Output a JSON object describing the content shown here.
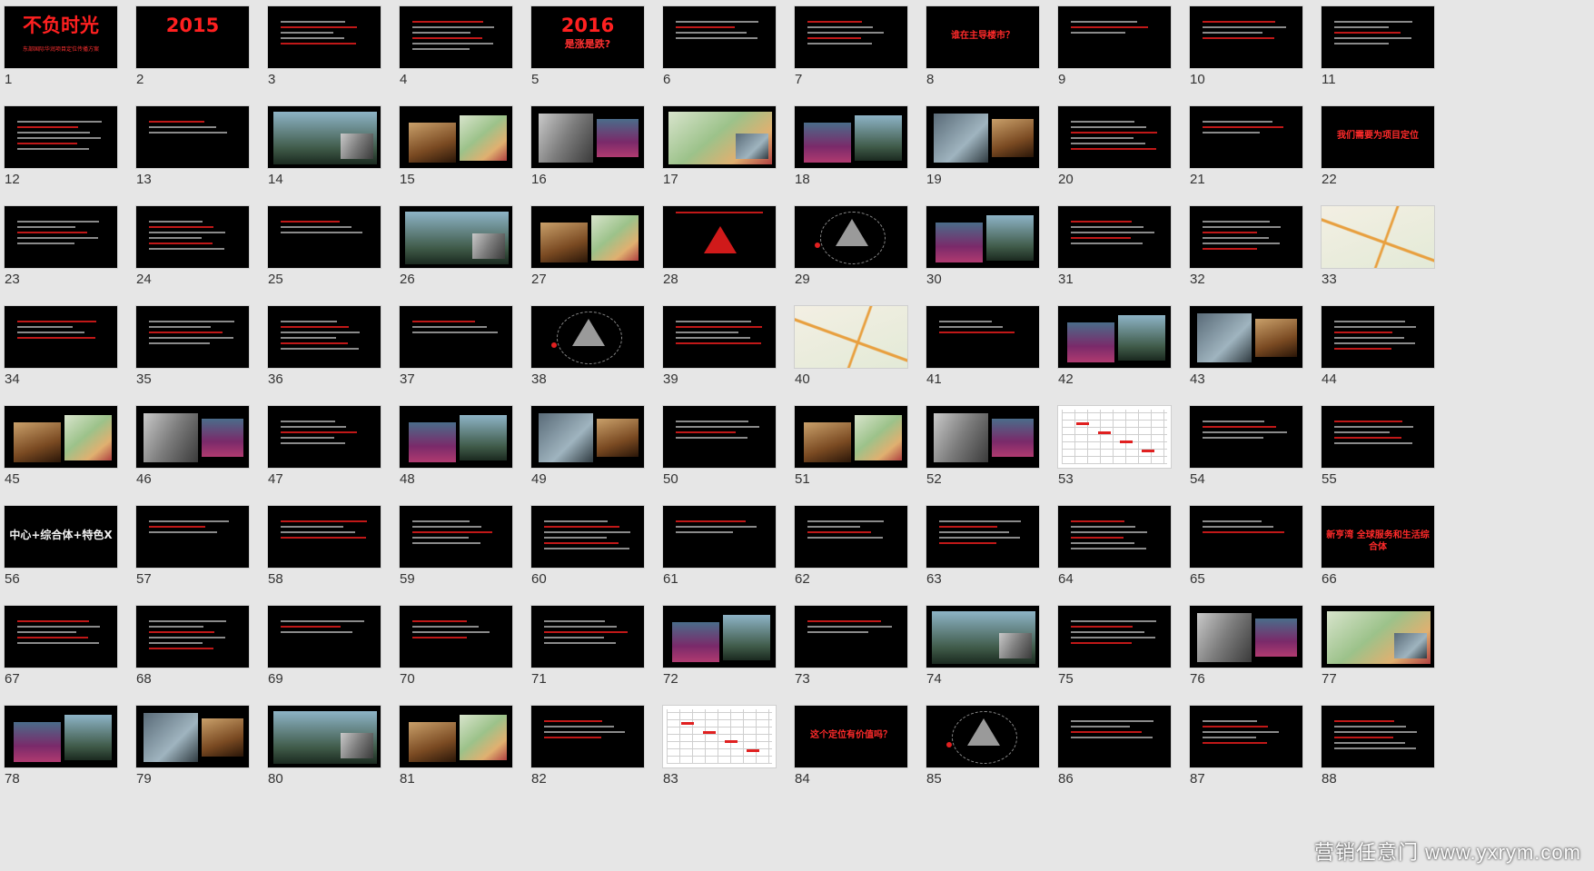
{
  "app": {
    "view": "slide-sorter"
  },
  "slides": [
    {
      "n": "1",
      "type": "title",
      "big": "不负时光",
      "sub": "东部国际华润项目定位传播方案"
    },
    {
      "n": "2",
      "type": "title",
      "big": "2015",
      "sub": ""
    },
    {
      "n": "3",
      "type": "text"
    },
    {
      "n": "4",
      "type": "text"
    },
    {
      "n": "5",
      "type": "title",
      "big": "2016",
      "sub": "是涨是跌?"
    },
    {
      "n": "6",
      "type": "text"
    },
    {
      "n": "7",
      "type": "text"
    },
    {
      "n": "8",
      "type": "mid",
      "mid": "谁在主导楼市？"
    },
    {
      "n": "9",
      "type": "text"
    },
    {
      "n": "10",
      "type": "text"
    },
    {
      "n": "11",
      "type": "text"
    },
    {
      "n": "12",
      "type": "text"
    },
    {
      "n": "13",
      "type": "text"
    },
    {
      "n": "14",
      "type": "photo"
    },
    {
      "n": "15",
      "type": "photo"
    },
    {
      "n": "16",
      "type": "photo"
    },
    {
      "n": "17",
      "type": "photo"
    },
    {
      "n": "18",
      "type": "photo"
    },
    {
      "n": "19",
      "type": "photo"
    },
    {
      "n": "20",
      "type": "text"
    },
    {
      "n": "21",
      "type": "text"
    },
    {
      "n": "22",
      "type": "mid",
      "mid": "我们需要为项目定位"
    },
    {
      "n": "23",
      "type": "text"
    },
    {
      "n": "24",
      "type": "text"
    },
    {
      "n": "25",
      "type": "text"
    },
    {
      "n": "26",
      "type": "photo"
    },
    {
      "n": "27",
      "type": "photo"
    },
    {
      "n": "28",
      "type": "triangle"
    },
    {
      "n": "29",
      "type": "ellipse"
    },
    {
      "n": "30",
      "type": "photo"
    },
    {
      "n": "31",
      "type": "text"
    },
    {
      "n": "32",
      "type": "text"
    },
    {
      "n": "33",
      "type": "map"
    },
    {
      "n": "34",
      "type": "text"
    },
    {
      "n": "35",
      "type": "text"
    },
    {
      "n": "36",
      "type": "text"
    },
    {
      "n": "37",
      "type": "text"
    },
    {
      "n": "38",
      "type": "ellipse"
    },
    {
      "n": "39",
      "type": "text"
    },
    {
      "n": "40",
      "type": "map"
    },
    {
      "n": "41",
      "type": "text"
    },
    {
      "n": "42",
      "type": "photo"
    },
    {
      "n": "43",
      "type": "photo"
    },
    {
      "n": "44",
      "type": "text"
    },
    {
      "n": "45",
      "type": "photo"
    },
    {
      "n": "46",
      "type": "photo"
    },
    {
      "n": "47",
      "type": "text"
    },
    {
      "n": "48",
      "type": "photo"
    },
    {
      "n": "49",
      "type": "photo"
    },
    {
      "n": "50",
      "type": "text"
    },
    {
      "n": "51",
      "type": "photo"
    },
    {
      "n": "52",
      "type": "photo"
    },
    {
      "n": "53",
      "type": "table"
    },
    {
      "n": "54",
      "type": "text"
    },
    {
      "n": "55",
      "type": "text"
    },
    {
      "n": "56",
      "type": "mid",
      "mid": "中心+综合体+特色X",
      "white": true
    },
    {
      "n": "57",
      "type": "text"
    },
    {
      "n": "58",
      "type": "text"
    },
    {
      "n": "59",
      "type": "text"
    },
    {
      "n": "60",
      "type": "text"
    },
    {
      "n": "61",
      "type": "text"
    },
    {
      "n": "62",
      "type": "text"
    },
    {
      "n": "63",
      "type": "text"
    },
    {
      "n": "64",
      "type": "text"
    },
    {
      "n": "65",
      "type": "text"
    },
    {
      "n": "66",
      "type": "mid",
      "mid": "新亨湾 全球服务和生活综合体"
    },
    {
      "n": "67",
      "type": "text"
    },
    {
      "n": "68",
      "type": "text"
    },
    {
      "n": "69",
      "type": "text"
    },
    {
      "n": "70",
      "type": "text"
    },
    {
      "n": "71",
      "type": "text"
    },
    {
      "n": "72",
      "type": "photo"
    },
    {
      "n": "73",
      "type": "text"
    },
    {
      "n": "74",
      "type": "photo"
    },
    {
      "n": "75",
      "type": "text"
    },
    {
      "n": "76",
      "type": "photo"
    },
    {
      "n": "77",
      "type": "photo"
    },
    {
      "n": "78",
      "type": "photo"
    },
    {
      "n": "79",
      "type": "photo"
    },
    {
      "n": "80",
      "type": "photo"
    },
    {
      "n": "81",
      "type": "photo"
    },
    {
      "n": "82",
      "type": "text"
    },
    {
      "n": "83",
      "type": "table"
    },
    {
      "n": "84",
      "type": "mid",
      "mid": "这个定位有价值吗？"
    },
    {
      "n": "85",
      "type": "ellipse"
    },
    {
      "n": "86",
      "type": "text"
    },
    {
      "n": "87",
      "type": "text"
    },
    {
      "n": "88",
      "type": "text"
    }
  ],
  "watermark": "营销任意门 www.yxrym.com"
}
